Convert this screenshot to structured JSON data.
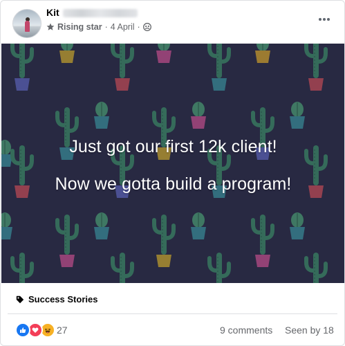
{
  "post": {
    "author": "Kit",
    "badge": "Rising star",
    "date": "4 April",
    "separator": "·",
    "privacy_icon": "group-privacy-icon",
    "menu_icon": "more-horizontal-icon"
  },
  "media": {
    "line1": "Just got our first 12k client!",
    "line2": "Now we gotta build a program!",
    "background_color": "#2a2b45",
    "pattern": "cactus-pots"
  },
  "topic": {
    "icon": "tag-icon",
    "label": "Success Stories"
  },
  "footer": {
    "reactions": [
      "like",
      "love",
      "haha"
    ],
    "reaction_count": "27",
    "comments": "9 comments",
    "seen": "Seen by 18"
  },
  "colors": {
    "like": "#1877f2",
    "love": "#f33e58",
    "haha": "#f7b125",
    "secondary_text": "#65676b"
  }
}
